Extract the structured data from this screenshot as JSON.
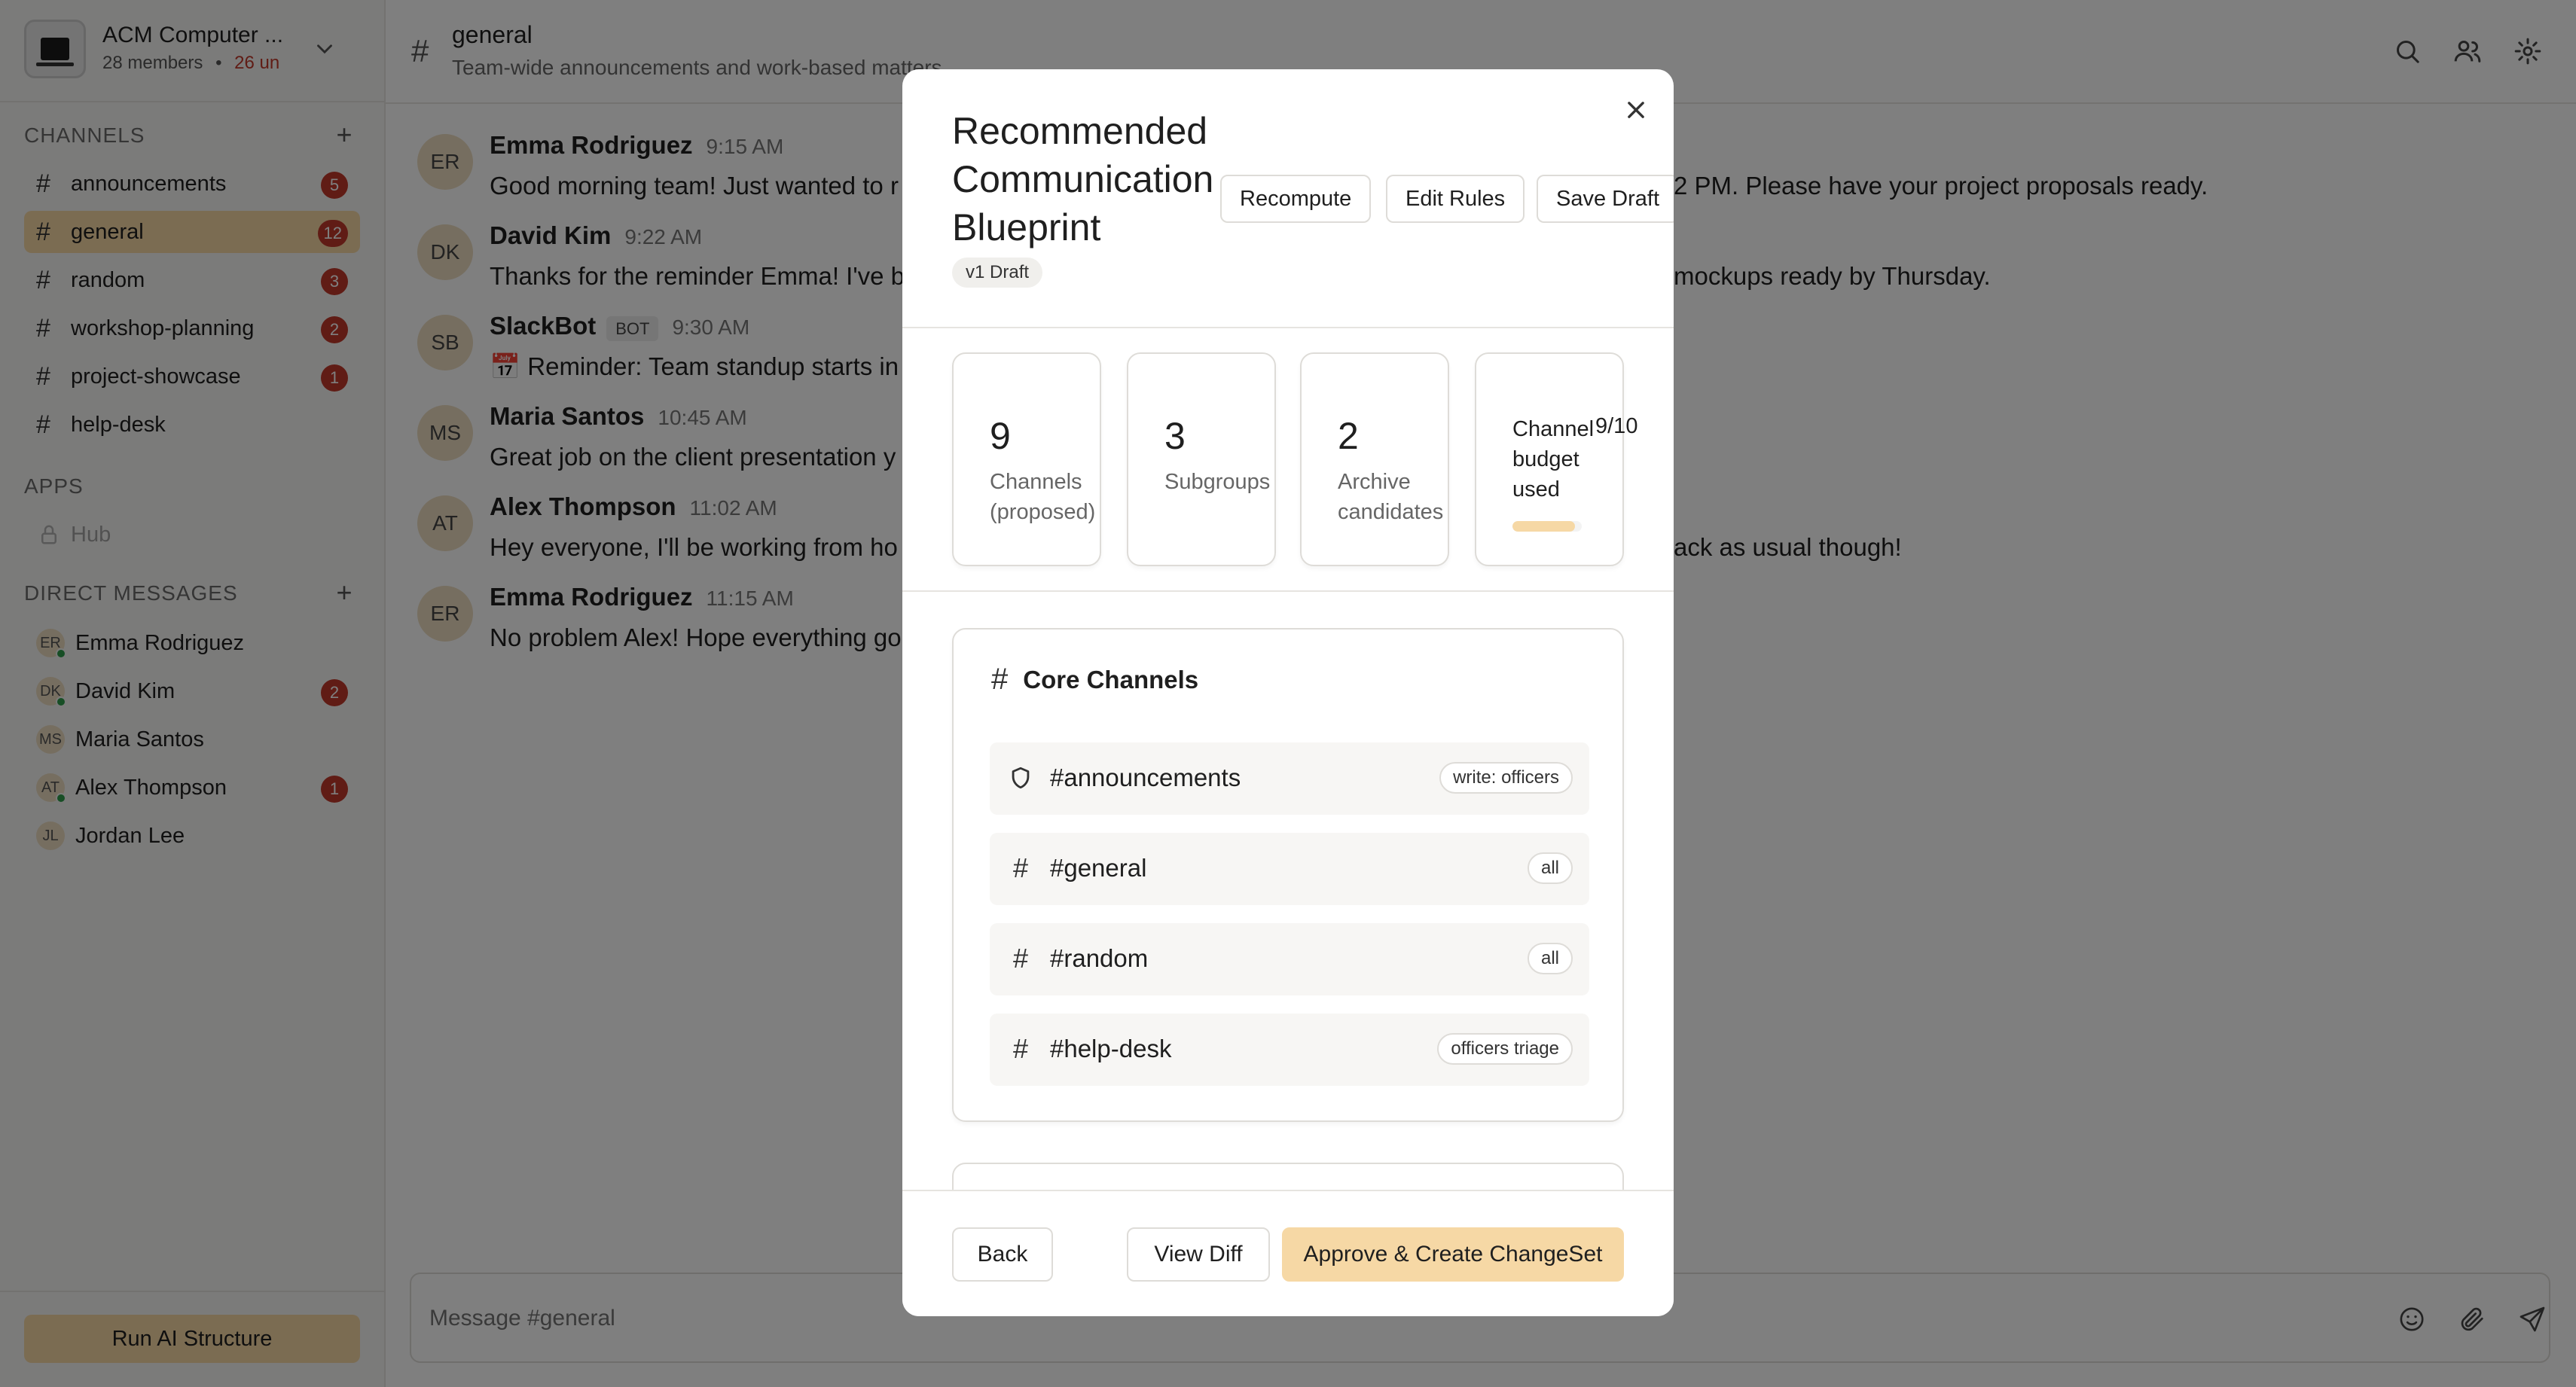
{
  "workspace": {
    "name": "ACM Computer ...",
    "members": "28 members",
    "separator": "•",
    "unread": "26 un"
  },
  "sidebar": {
    "channels_title": "CHANNELS",
    "channels": [
      {
        "label": "announcements",
        "badge": "5",
        "active": false
      },
      {
        "label": "general",
        "badge": "12",
        "active": true
      },
      {
        "label": "random",
        "badge": "3",
        "active": false
      },
      {
        "label": "workshop-planning",
        "badge": "2",
        "active": false
      },
      {
        "label": "project-showcase",
        "badge": "1",
        "active": false
      },
      {
        "label": "help-desk",
        "badge": "",
        "active": false
      }
    ],
    "apps_title": "APPS",
    "apps": [
      {
        "label": "Hub",
        "icon": "lock-icon"
      }
    ],
    "dm_title": "DIRECT MESSAGES",
    "dms": [
      {
        "initials": "ER",
        "label": "Emma Rodriguez",
        "badge": "",
        "online": true
      },
      {
        "initials": "DK",
        "label": "David Kim",
        "badge": "2",
        "online": true
      },
      {
        "initials": "MS",
        "label": "Maria Santos",
        "badge": "",
        "online": false
      },
      {
        "initials": "AT",
        "label": "Alex Thompson",
        "badge": "1",
        "online": true
      },
      {
        "initials": "JL",
        "label": "Jordan Lee",
        "badge": "",
        "online": false
      }
    ],
    "run_ai_label": "Run AI Structure"
  },
  "channel": {
    "hash": "#",
    "name": "general",
    "topic": "Team-wide announcements and work-based matters"
  },
  "messages": [
    {
      "initials": "ER",
      "name": "Emma Rodriguez",
      "time": "9:15 AM",
      "bot": "",
      "text": "Good morning team! Just wanted to r",
      "text_right": "2 PM. Please have your project proposals ready."
    },
    {
      "initials": "DK",
      "name": "David Kim",
      "time": "9:22 AM",
      "bot": "",
      "text": "Thanks for the reminder Emma! I've b",
      "text_right": "mockups ready by Thursday."
    },
    {
      "initials": "SB",
      "name": "SlackBot",
      "time": "9:30 AM",
      "bot": "BOT",
      "text": "📅 Reminder: Team standup starts in",
      "text_right": ""
    },
    {
      "initials": "MS",
      "name": "Maria Santos",
      "time": "10:45 AM",
      "bot": "",
      "text": "Great job on the client presentation y",
      "text_right": ""
    },
    {
      "initials": "AT",
      "name": "Alex Thompson",
      "time": "11:02 AM",
      "bot": "",
      "text": "Hey everyone, I'll be working from ho",
      "text_right": "ack as usual though!"
    },
    {
      "initials": "ER",
      "name": "Emma Rodriguez",
      "time": "11:15 AM",
      "bot": "",
      "text": "No problem Alex! Hope everything go",
      "text_right": ""
    }
  ],
  "composer": {
    "placeholder": "Message #general"
  },
  "modal": {
    "title": "Recommended Communication Blueprint",
    "version": "v1 Draft",
    "header_buttons": {
      "recompute": "Recompute",
      "edit_rules": "Edit Rules",
      "save_draft": "Save Draft"
    },
    "stats": [
      {
        "value": "9",
        "label": "Channels (proposed)"
      },
      {
        "value": "3",
        "label": "Subgroups"
      },
      {
        "value": "2",
        "label": "Archive candidates"
      }
    ],
    "budget": {
      "label": "Channel budget used",
      "value": "9/10",
      "fraction": 0.9
    },
    "core": {
      "title": "Core Channels",
      "rows": [
        {
          "icon": "shield-icon",
          "name": "#announcements",
          "perm": "write: officers"
        },
        {
          "icon": "hash-icon",
          "name": "#general",
          "perm": "all"
        },
        {
          "icon": "hash-icon",
          "name": "#random",
          "perm": "all"
        },
        {
          "icon": "hash-icon",
          "name": "#help-desk",
          "perm": "officers triage"
        }
      ]
    },
    "footer": {
      "back": "Back",
      "view_diff": "View Diff",
      "approve": "Approve & Create ChangeSet"
    }
  },
  "colors": {
    "accent": "#f6d8a5",
    "badge": "#c0392b",
    "online": "#2e9d4a"
  }
}
